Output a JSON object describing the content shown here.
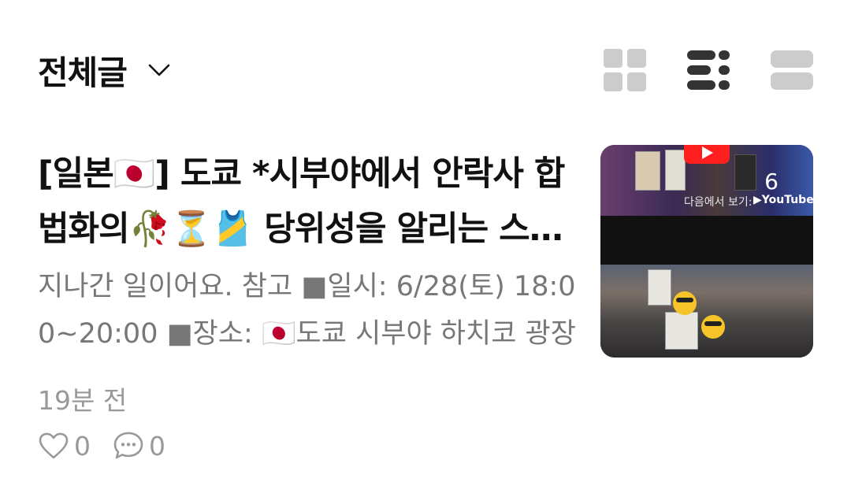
{
  "header": {
    "filter_label": "전체글",
    "filter_icon": "chevron-down-icon",
    "view_modes": [
      "grid-view-icon",
      "list-view-icon",
      "card-view-icon"
    ],
    "active_view": "list-view-icon"
  },
  "post": {
    "title": "[일본🇯🇵] 도쿄 *시부야에서 안락사 합법화의🥀⏳🎽 당위성을 알리는 스탠딩",
    "excerpt": "지나간 일이어요. 참고 ■일시: 6/28(토) 18:00~20:00 ■장소: 🇯🇵도쿄 시부야 하치코 광장",
    "time": "19분 전",
    "likes": "0",
    "comments": "0",
    "thumbnail": {
      "count": "6",
      "watch_on": "다음에서 보기:",
      "youtube": "▶YouTube"
    }
  },
  "colors": {
    "text_primary": "#111111",
    "text_secondary": "#777777",
    "text_meta": "#999999",
    "icon_active": "#333333",
    "icon_inactive": "#cccccc"
  }
}
